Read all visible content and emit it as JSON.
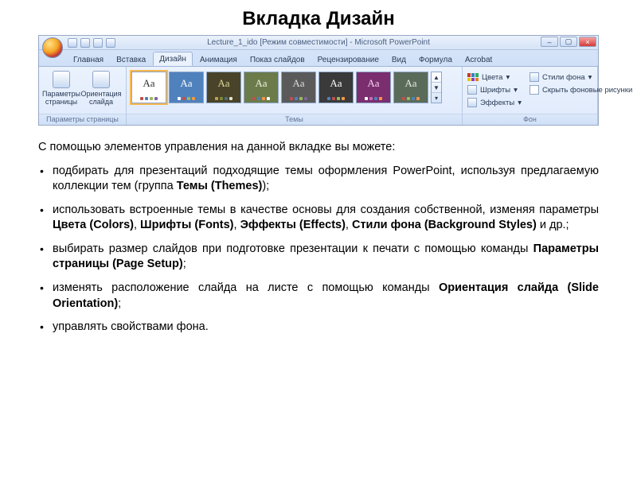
{
  "title": "Вкладка Дизайн",
  "ribbon": {
    "doc_title": "Lecture_1_ido [Режим совместимости] - Microsoft PowerPoint",
    "tabs": [
      "Главная",
      "Вставка",
      "Дизайн",
      "Анимация",
      "Показ слайдов",
      "Рецензирование",
      "Вид",
      "Формула",
      "Acrobat"
    ],
    "active_tab_index": 2,
    "page_group": {
      "label": "Параметры страницы",
      "page_setup": "Параметры страницы",
      "orientation": "Ориентация слайда"
    },
    "themes_group": {
      "label": "Темы",
      "thumbs": [
        {
          "bg": "#ffffff",
          "fg": "#333333",
          "dots": [
            "#c0504d",
            "#4f81bd",
            "#9bbb59",
            "#8064a2"
          ]
        },
        {
          "bg": "#4f81bd",
          "fg": "#ffffff",
          "dots": [
            "#ffffff",
            "#c0504d",
            "#9bbb59",
            "#f79646"
          ]
        },
        {
          "bg": "#494429",
          "fg": "#e0d79a",
          "dots": [
            "#c0a04d",
            "#7a8a3a",
            "#4f6e81",
            "#e6e1c4"
          ]
        },
        {
          "bg": "#6b7b4a",
          "fg": "#eef2e0",
          "dots": [
            "#c0504d",
            "#4f81bd",
            "#f79646",
            "#ffffff"
          ]
        },
        {
          "bg": "#5a5a5a",
          "fg": "#dddddd",
          "dots": [
            "#c0504d",
            "#4f81bd",
            "#9bbb59",
            "#8064a2"
          ]
        },
        {
          "bg": "#3a3a3a",
          "fg": "#ffffff",
          "dots": [
            "#4f81bd",
            "#c0504d",
            "#9bbb59",
            "#f79646"
          ]
        },
        {
          "bg": "#7a2e6e",
          "fg": "#f5d6ef",
          "dots": [
            "#ffffff",
            "#c76bb9",
            "#4f81bd",
            "#f79646"
          ]
        },
        {
          "bg": "#5a6b5a",
          "fg": "#e6ece6",
          "dots": [
            "#c0504d",
            "#9bbb59",
            "#4f81bd",
            "#f79646"
          ]
        }
      ]
    },
    "bg_group": {
      "label": "Фон",
      "colors": "Цвета",
      "fonts": "Шрифты",
      "effects": "Эффекты",
      "styles": "Стили фона",
      "hide_bg": "Скрыть фоновые рисунки"
    }
  },
  "intro": "С помощью элементов управления на данной вкладке вы можете:",
  "bullets": [
    {
      "parts": [
        {
          "t": "подбирать для презентаций подходящие темы оформления PowerPoint, используя предлагаемую коллекции тем (группа "
        },
        {
          "t": "Темы (Themes)",
          "b": true
        },
        {
          "t": ");"
        }
      ]
    },
    {
      "parts": [
        {
          "t": "использовать встроенные темы в качестве основы для создания собственной, изменяя параметры "
        },
        {
          "t": "Цвета (Colors)",
          "b": true
        },
        {
          "t": ", "
        },
        {
          "t": "Шрифты (Fonts)",
          "b": true
        },
        {
          "t": ", "
        },
        {
          "t": "Эффекты (Effects)",
          "b": true
        },
        {
          "t": ", "
        },
        {
          "t": "Стили фона (Background Styles)",
          "b": true
        },
        {
          "t": " и др.;"
        }
      ]
    },
    {
      "parts": [
        {
          "t": "выбирать размер слайдов при подготовке презентации к печати с помощью команды "
        },
        {
          "t": "Параметры страницы (Page Setup)",
          "b": true
        },
        {
          "t": ";"
        }
      ]
    },
    {
      "parts": [
        {
          "t": "изменять расположение слайда на листе с помощью команды "
        },
        {
          "t": "Ориентация слайда (Slide Orientation)",
          "b": true
        },
        {
          "t": ";"
        }
      ]
    },
    {
      "parts": [
        {
          "t": "управлять свойствами фона."
        }
      ]
    }
  ]
}
